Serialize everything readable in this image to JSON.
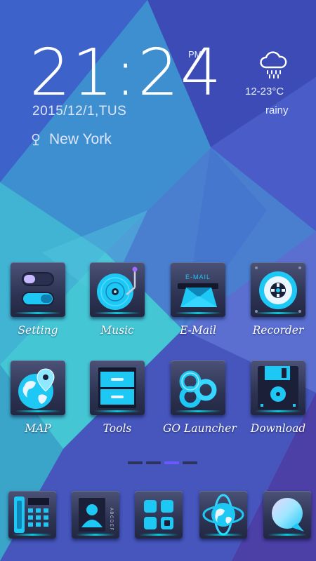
{
  "clock": {
    "time": "21:24",
    "ampm": "PM",
    "date": "2015/12/1,TUS",
    "location": "New York"
  },
  "weather": {
    "icon": "rain-cloud-icon",
    "temperature": "12-23°C",
    "condition": "rainy"
  },
  "apps": [
    {
      "label": "Setting",
      "icon": "toggle-switches-icon"
    },
    {
      "label": "Music",
      "icon": "turntable-icon"
    },
    {
      "label": "E-Mail",
      "icon": "email-slot-icon"
    },
    {
      "label": "Recorder",
      "icon": "cassette-reel-icon"
    },
    {
      "label": "MAP",
      "icon": "globe-pin-icon"
    },
    {
      "label": "Tools",
      "icon": "drawers-icon"
    },
    {
      "label": "GO Launcher",
      "icon": "go-logo-icon"
    },
    {
      "label": "Download",
      "icon": "floppy-disk-icon"
    }
  ],
  "email_icon_text": "E-MAIL",
  "contacts_index_letters": "A B C D E F",
  "pager": {
    "pages": 4,
    "active_index": 2
  },
  "dock": [
    {
      "icon": "phone-dialer-icon"
    },
    {
      "icon": "contacts-icon"
    },
    {
      "icon": "app-drawer-icon"
    },
    {
      "icon": "browser-globe-icon"
    },
    {
      "icon": "messaging-bubble-icon"
    }
  ],
  "colors": {
    "accent": "#1ec8f5",
    "pager_active": "#6b58ff"
  }
}
